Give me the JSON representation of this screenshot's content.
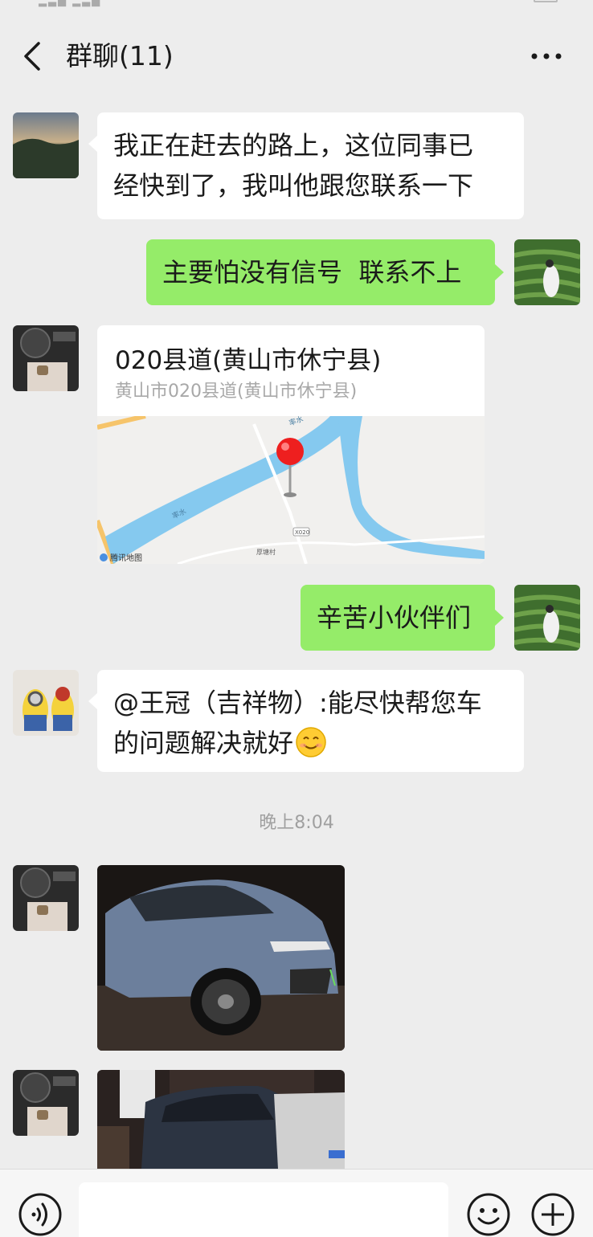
{
  "header": {
    "title": "群聊(11)"
  },
  "messages": [
    {
      "side": "left",
      "text_lines": [
        "我正在赶去的路上，这位同事已",
        "经快到了，我叫他跟您联系一下"
      ]
    },
    {
      "side": "right",
      "text": "主要怕没有信号  联系不上"
    },
    {
      "side": "left",
      "type": "location",
      "title": "020县道(黄山市休宁县)",
      "address": "黄山市020县道(黄山市休宁县)",
      "map_labels": {
        "river_1": "率水",
        "river_2": "率水",
        "road": "X020",
        "village": "厚塘村",
        "provider": "腾讯地图"
      }
    },
    {
      "side": "right",
      "text": "辛苦小伙伴们"
    },
    {
      "side": "left",
      "text_lines": [
        "@王冠（吉祥物）:能尽快帮您车",
        "的问题解决就好"
      ]
    },
    {
      "side": "left",
      "type": "image"
    },
    {
      "side": "left",
      "type": "image"
    }
  ],
  "timestamp": "晚上8:04",
  "colors": {
    "background": "#ededed",
    "sent_bubble": "#95ec69",
    "received_bubble": "#ffffff"
  },
  "input_bar": {
    "placeholder": ""
  }
}
